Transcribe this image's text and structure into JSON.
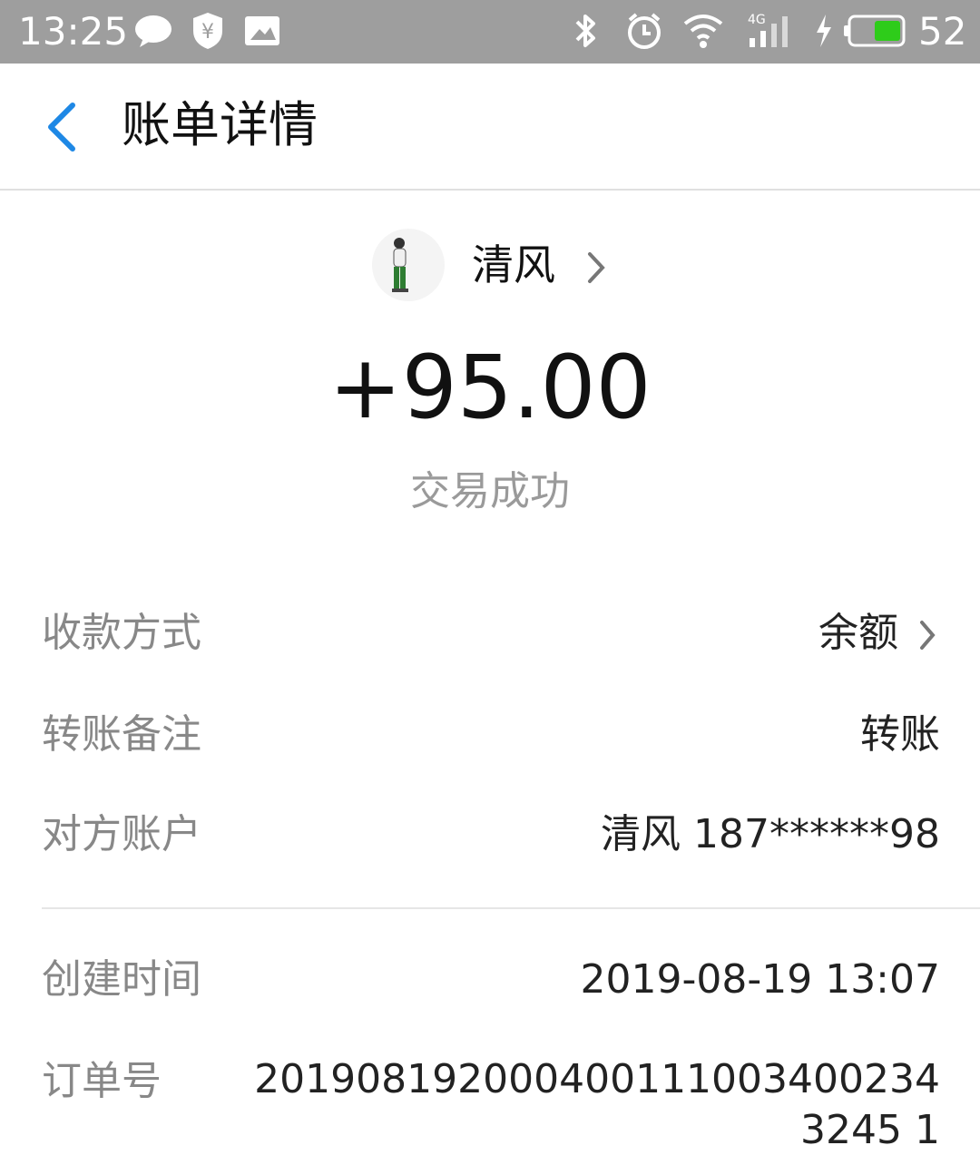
{
  "status_bar": {
    "time": "13:25",
    "battery_level": "52",
    "icons": [
      "chat-bubble-icon",
      "yuan-shield-icon",
      "image-icon",
      "bluetooth-icon",
      "alarm-icon",
      "wifi-icon",
      "signal-4g-icon",
      "charging-icon",
      "battery-icon"
    ],
    "network_label": "4G"
  },
  "header": {
    "title": "账单详情"
  },
  "payer": {
    "name": "清风"
  },
  "transaction": {
    "amount": "+95.00",
    "status": "交易成功"
  },
  "details": [
    {
      "label": "收款方式",
      "value": "余额"
    },
    {
      "label": "转账备注",
      "value": "转账"
    },
    {
      "label": "对方账户",
      "value": "清风 187******98"
    },
    {
      "label": "创建时间",
      "value": "2019-08-19 13:07"
    },
    {
      "label": "订单号",
      "value": "2019081920004001110034002343245 1"
    }
  ],
  "colors": {
    "accent": "#1e88e5",
    "status_bar": "#9e9e9e",
    "battery_fill": "#2ecc1a",
    "label_gray": "#888888"
  }
}
